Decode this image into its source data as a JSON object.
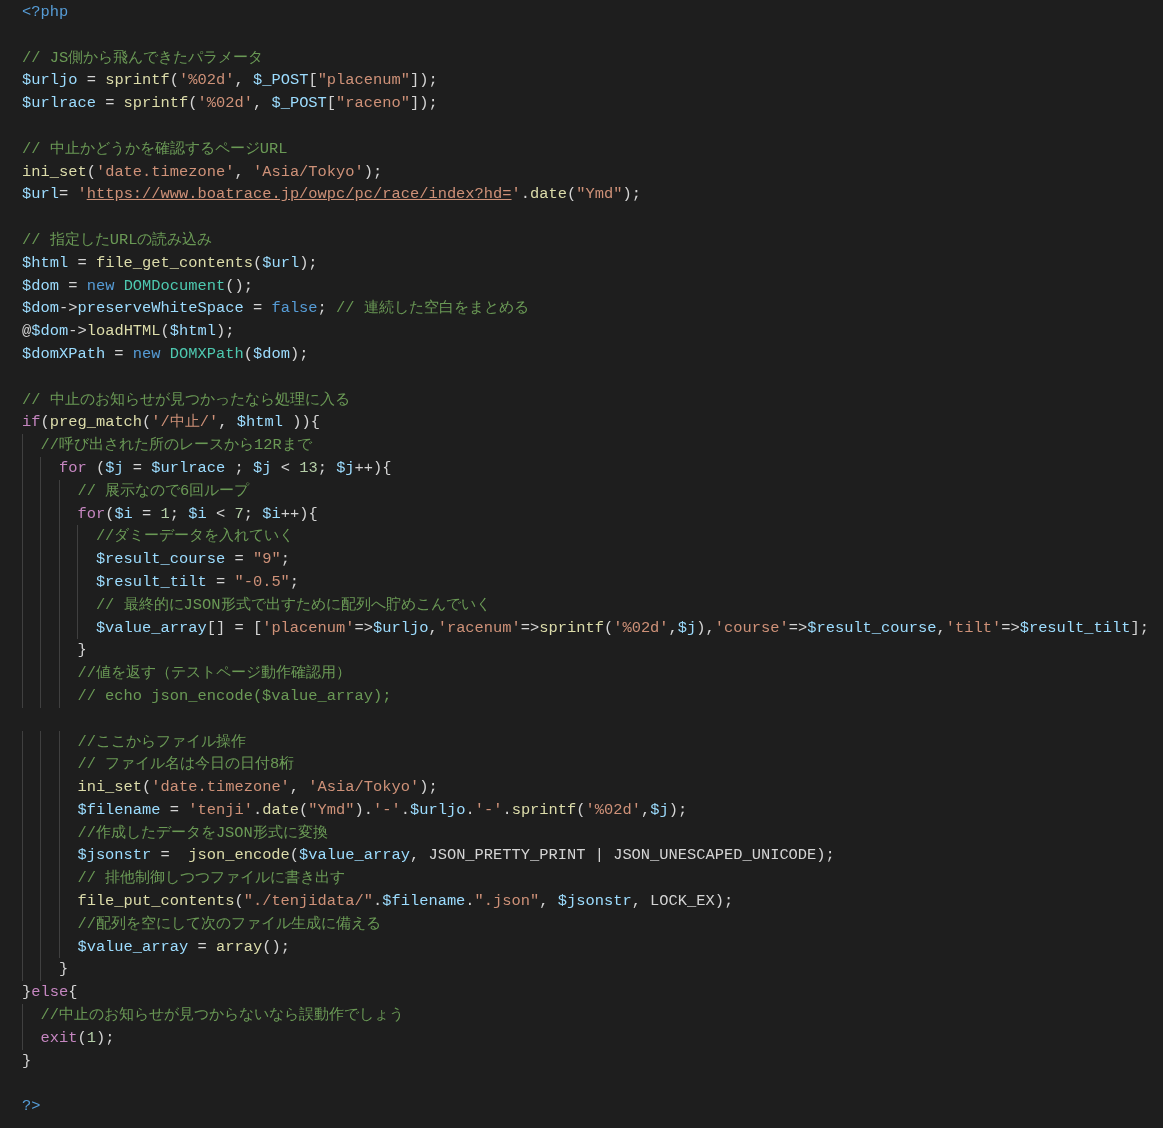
{
  "editor": {
    "lines": [
      {
        "kind": "code",
        "tokens": [
          {
            "kind": "kw",
            "text": "<?php"
          }
        ]
      },
      {
        "kind": "blank"
      },
      {
        "kind": "code",
        "tokens": [
          {
            "kind": "cmt",
            "text": "// JS側から飛んできたパラメータ"
          }
        ]
      },
      {
        "kind": "code",
        "tokens": [
          {
            "kind": "var",
            "text": "$urljo"
          },
          {
            "kind": "txt",
            "text": " = "
          },
          {
            "kind": "fn",
            "text": "sprintf"
          },
          {
            "kind": "txt",
            "text": "("
          },
          {
            "kind": "str",
            "text": "'%02d'"
          },
          {
            "kind": "txt",
            "text": ", "
          },
          {
            "kind": "var",
            "text": "$_POST"
          },
          {
            "kind": "txt",
            "text": "["
          },
          {
            "kind": "str",
            "text": "\"placenum\""
          },
          {
            "kind": "txt",
            "text": "]);"
          }
        ]
      },
      {
        "kind": "code",
        "tokens": [
          {
            "kind": "var",
            "text": "$urlrace"
          },
          {
            "kind": "txt",
            "text": " = "
          },
          {
            "kind": "fn",
            "text": "sprintf"
          },
          {
            "kind": "txt",
            "text": "("
          },
          {
            "kind": "str",
            "text": "'%02d'"
          },
          {
            "kind": "txt",
            "text": ", "
          },
          {
            "kind": "var",
            "text": "$_POST"
          },
          {
            "kind": "txt",
            "text": "["
          },
          {
            "kind": "str",
            "text": "\"raceno\""
          },
          {
            "kind": "txt",
            "text": "]);"
          }
        ]
      },
      {
        "kind": "blank"
      },
      {
        "kind": "code",
        "tokens": [
          {
            "kind": "cmt",
            "text": "// 中止かどうかを確認するページURL"
          }
        ]
      },
      {
        "kind": "code",
        "tokens": [
          {
            "kind": "fn",
            "text": "ini_set"
          },
          {
            "kind": "txt",
            "text": "("
          },
          {
            "kind": "str",
            "text": "'date.timezone'"
          },
          {
            "kind": "txt",
            "text": ", "
          },
          {
            "kind": "str",
            "text": "'Asia/Tokyo'"
          },
          {
            "kind": "txt",
            "text": ");"
          }
        ]
      },
      {
        "kind": "code",
        "tokens": [
          {
            "kind": "var",
            "text": "$url"
          },
          {
            "kind": "txt",
            "text": "= "
          },
          {
            "kind": "str",
            "text": "'"
          },
          {
            "kind": "link",
            "text": "https://www.boatrace.jp/owpc/pc/race/index?hd="
          },
          {
            "kind": "str",
            "text": "'"
          },
          {
            "kind": "txt",
            "text": "."
          },
          {
            "kind": "fn",
            "text": "date"
          },
          {
            "kind": "txt",
            "text": "("
          },
          {
            "kind": "str",
            "text": "\"Ymd\""
          },
          {
            "kind": "txt",
            "text": ");"
          }
        ]
      },
      {
        "kind": "blank"
      },
      {
        "kind": "code",
        "tokens": [
          {
            "kind": "cmt",
            "text": "// 指定したURLの読み込み"
          }
        ]
      },
      {
        "kind": "code",
        "tokens": [
          {
            "kind": "var",
            "text": "$html"
          },
          {
            "kind": "txt",
            "text": " = "
          },
          {
            "kind": "fn",
            "text": "file_get_contents"
          },
          {
            "kind": "txt",
            "text": "("
          },
          {
            "kind": "var",
            "text": "$url"
          },
          {
            "kind": "txt",
            "text": ");"
          }
        ]
      },
      {
        "kind": "code",
        "tokens": [
          {
            "kind": "var",
            "text": "$dom"
          },
          {
            "kind": "txt",
            "text": " = "
          },
          {
            "kind": "kw",
            "text": "new "
          },
          {
            "kind": "cls",
            "text": "DOMDocument"
          },
          {
            "kind": "txt",
            "text": "();"
          }
        ]
      },
      {
        "kind": "code",
        "tokens": [
          {
            "kind": "var",
            "text": "$dom"
          },
          {
            "kind": "txt",
            "text": "->"
          },
          {
            "kind": "var",
            "text": "preserveWhiteSpace"
          },
          {
            "kind": "txt",
            "text": " = "
          },
          {
            "kind": "kw",
            "text": "false"
          },
          {
            "kind": "txt",
            "text": "; "
          },
          {
            "kind": "cmt",
            "text": "// 連続した空白をまとめる"
          }
        ]
      },
      {
        "kind": "code",
        "tokens": [
          {
            "kind": "txt",
            "text": "@"
          },
          {
            "kind": "var",
            "text": "$dom"
          },
          {
            "kind": "txt",
            "text": "->"
          },
          {
            "kind": "fn",
            "text": "loadHTML"
          },
          {
            "kind": "txt",
            "text": "("
          },
          {
            "kind": "var",
            "text": "$html"
          },
          {
            "kind": "txt",
            "text": ");"
          }
        ]
      },
      {
        "kind": "code",
        "tokens": [
          {
            "kind": "var",
            "text": "$domXPath"
          },
          {
            "kind": "txt",
            "text": " = "
          },
          {
            "kind": "kw",
            "text": "new "
          },
          {
            "kind": "cls",
            "text": "DOMXPath"
          },
          {
            "kind": "txt",
            "text": "("
          },
          {
            "kind": "var",
            "text": "$dom"
          },
          {
            "kind": "txt",
            "text": ");"
          }
        ]
      },
      {
        "kind": "blank"
      },
      {
        "kind": "code",
        "tokens": [
          {
            "kind": "cmt",
            "text": "// 中止のお知らせが見つかったなら処理に入る"
          }
        ]
      },
      {
        "kind": "code",
        "tokens": [
          {
            "kind": "ctl",
            "text": "if"
          },
          {
            "kind": "txt",
            "text": "("
          },
          {
            "kind": "fn",
            "text": "preg_match"
          },
          {
            "kind": "txt",
            "text": "("
          },
          {
            "kind": "str",
            "text": "'/中止/'"
          },
          {
            "kind": "txt",
            "text": ", "
          },
          {
            "kind": "var",
            "text": "$html"
          },
          {
            "kind": "txt",
            "text": " )){"
          }
        ]
      },
      {
        "kind": "code",
        "tokens": [
          {
            "kind": "cmt",
            "text": "  //呼び出された所のレースから12Rまで"
          }
        ]
      },
      {
        "kind": "code",
        "tokens": [
          {
            "kind": "ctl",
            "text": "    for"
          },
          {
            "kind": "txt",
            "text": " ("
          },
          {
            "kind": "var",
            "text": "$j"
          },
          {
            "kind": "txt",
            "text": " = "
          },
          {
            "kind": "var",
            "text": "$urlrace"
          },
          {
            "kind": "txt",
            "text": " ; "
          },
          {
            "kind": "var",
            "text": "$j"
          },
          {
            "kind": "txt",
            "text": " < "
          },
          {
            "kind": "num",
            "text": "13"
          },
          {
            "kind": "txt",
            "text": "; "
          },
          {
            "kind": "var",
            "text": "$j"
          },
          {
            "kind": "txt",
            "text": "++){"
          }
        ]
      },
      {
        "kind": "code",
        "tokens": [
          {
            "kind": "cmt",
            "text": "      // 展示なので6回ループ"
          }
        ]
      },
      {
        "kind": "code",
        "tokens": [
          {
            "kind": "ctl",
            "text": "      for"
          },
          {
            "kind": "txt",
            "text": "("
          },
          {
            "kind": "var",
            "text": "$i"
          },
          {
            "kind": "txt",
            "text": " = "
          },
          {
            "kind": "num",
            "text": "1"
          },
          {
            "kind": "txt",
            "text": "; "
          },
          {
            "kind": "var",
            "text": "$i"
          },
          {
            "kind": "txt",
            "text": " < "
          },
          {
            "kind": "num",
            "text": "7"
          },
          {
            "kind": "txt",
            "text": "; "
          },
          {
            "kind": "var",
            "text": "$i"
          },
          {
            "kind": "txt",
            "text": "++){"
          }
        ]
      },
      {
        "kind": "code",
        "tokens": [
          {
            "kind": "cmt",
            "text": "        //ダミーデータを入れていく"
          }
        ]
      },
      {
        "kind": "code",
        "tokens": [
          {
            "kind": "var",
            "text": "        $result_course"
          },
          {
            "kind": "txt",
            "text": " = "
          },
          {
            "kind": "str",
            "text": "\"9\""
          },
          {
            "kind": "txt",
            "text": ";"
          }
        ]
      },
      {
        "kind": "code",
        "tokens": [
          {
            "kind": "var",
            "text": "        $result_tilt"
          },
          {
            "kind": "txt",
            "text": " = "
          },
          {
            "kind": "str",
            "text": "\"-0.5\""
          },
          {
            "kind": "txt",
            "text": ";"
          }
        ]
      },
      {
        "kind": "code",
        "tokens": [
          {
            "kind": "cmt",
            "text": "        // 最終的にJSON形式で出すために配列へ貯めこんでいく"
          }
        ]
      },
      {
        "kind": "code",
        "tokens": [
          {
            "kind": "var",
            "text": "        $value_array"
          },
          {
            "kind": "txt",
            "text": "[] = ["
          },
          {
            "kind": "str",
            "text": "'placenum'"
          },
          {
            "kind": "txt",
            "text": "=>"
          },
          {
            "kind": "var",
            "text": "$urljo"
          },
          {
            "kind": "txt",
            "text": ","
          },
          {
            "kind": "str",
            "text": "'racenum'"
          },
          {
            "kind": "txt",
            "text": "=>"
          },
          {
            "kind": "fn",
            "text": "sprintf"
          },
          {
            "kind": "txt",
            "text": "("
          },
          {
            "kind": "str",
            "text": "'%02d'"
          },
          {
            "kind": "txt",
            "text": ","
          },
          {
            "kind": "var",
            "text": "$j"
          },
          {
            "kind": "txt",
            "text": "),"
          },
          {
            "kind": "str",
            "text": "'course'"
          },
          {
            "kind": "txt",
            "text": "=>"
          },
          {
            "kind": "var",
            "text": "$result_course"
          },
          {
            "kind": "txt",
            "text": ","
          },
          {
            "kind": "str",
            "text": "'tilt'"
          },
          {
            "kind": "txt",
            "text": "=>"
          },
          {
            "kind": "var",
            "text": "$result_tilt"
          },
          {
            "kind": "txt",
            "text": "];"
          }
        ]
      },
      {
        "kind": "code",
        "tokens": [
          {
            "kind": "txt",
            "text": "      }"
          }
        ]
      },
      {
        "kind": "code",
        "tokens": [
          {
            "kind": "cmt",
            "text": "      //値を返す（テストページ動作確認用）"
          }
        ]
      },
      {
        "kind": "code",
        "tokens": [
          {
            "kind": "cmt",
            "text": "      // echo json_encode($value_array);"
          }
        ]
      },
      {
        "kind": "blank"
      },
      {
        "kind": "code",
        "tokens": [
          {
            "kind": "cmt",
            "text": "      //ここからファイル操作"
          }
        ]
      },
      {
        "kind": "code",
        "tokens": [
          {
            "kind": "cmt",
            "text": "      // ファイル名は今日の日付8桁"
          }
        ]
      },
      {
        "kind": "code",
        "tokens": [
          {
            "kind": "fn",
            "text": "      ini_set"
          },
          {
            "kind": "txt",
            "text": "("
          },
          {
            "kind": "str",
            "text": "'date.timezone'"
          },
          {
            "kind": "txt",
            "text": ", "
          },
          {
            "kind": "str",
            "text": "'Asia/Tokyo'"
          },
          {
            "kind": "txt",
            "text": ");"
          }
        ]
      },
      {
        "kind": "code",
        "tokens": [
          {
            "kind": "var",
            "text": "      $filename"
          },
          {
            "kind": "txt",
            "text": " = "
          },
          {
            "kind": "str",
            "text": "'tenji'"
          },
          {
            "kind": "txt",
            "text": "."
          },
          {
            "kind": "fn",
            "text": "date"
          },
          {
            "kind": "txt",
            "text": "("
          },
          {
            "kind": "str",
            "text": "\"Ymd\""
          },
          {
            "kind": "txt",
            "text": ")."
          },
          {
            "kind": "str",
            "text": "'-'"
          },
          {
            "kind": "txt",
            "text": "."
          },
          {
            "kind": "var",
            "text": "$urljo"
          },
          {
            "kind": "txt",
            "text": "."
          },
          {
            "kind": "str",
            "text": "'-'"
          },
          {
            "kind": "txt",
            "text": "."
          },
          {
            "kind": "fn",
            "text": "sprintf"
          },
          {
            "kind": "txt",
            "text": "("
          },
          {
            "kind": "str",
            "text": "'%02d'"
          },
          {
            "kind": "txt",
            "text": ","
          },
          {
            "kind": "var",
            "text": "$j"
          },
          {
            "kind": "txt",
            "text": ");"
          }
        ]
      },
      {
        "kind": "code",
        "tokens": [
          {
            "kind": "cmt",
            "text": "      //作成したデータをJSON形式に変換"
          }
        ]
      },
      {
        "kind": "code",
        "tokens": [
          {
            "kind": "var",
            "text": "      $jsonstr"
          },
          {
            "kind": "txt",
            "text": " =  "
          },
          {
            "kind": "fn",
            "text": "json_encode"
          },
          {
            "kind": "txt",
            "text": "("
          },
          {
            "kind": "var",
            "text": "$value_array"
          },
          {
            "kind": "txt",
            "text": ", JSON_PRETTY_PRINT | JSON_UNESCAPED_UNICODE);"
          }
        ]
      },
      {
        "kind": "code",
        "tokens": [
          {
            "kind": "cmt",
            "text": "      // 排他制御しつつファイルに書き出す"
          }
        ]
      },
      {
        "kind": "code",
        "tokens": [
          {
            "kind": "fn",
            "text": "      file_put_contents"
          },
          {
            "kind": "txt",
            "text": "("
          },
          {
            "kind": "str",
            "text": "\"./tenjidata/\""
          },
          {
            "kind": "txt",
            "text": "."
          },
          {
            "kind": "var",
            "text": "$filename"
          },
          {
            "kind": "txt",
            "text": "."
          },
          {
            "kind": "str",
            "text": "\".json\""
          },
          {
            "kind": "txt",
            "text": ", "
          },
          {
            "kind": "var",
            "text": "$jsonstr"
          },
          {
            "kind": "txt",
            "text": ", LOCK_EX);"
          }
        ]
      },
      {
        "kind": "code",
        "tokens": [
          {
            "kind": "cmt",
            "text": "      //配列を空にして次のファイル生成に備える"
          }
        ]
      },
      {
        "kind": "code",
        "tokens": [
          {
            "kind": "var",
            "text": "      $value_array"
          },
          {
            "kind": "txt",
            "text": " = "
          },
          {
            "kind": "fn",
            "text": "array"
          },
          {
            "kind": "txt",
            "text": "();"
          }
        ]
      },
      {
        "kind": "code",
        "tokens": [
          {
            "kind": "txt",
            "text": "    }"
          }
        ]
      },
      {
        "kind": "code",
        "tokens": [
          {
            "kind": "txt",
            "text": "}"
          },
          {
            "kind": "ctl",
            "text": "else"
          },
          {
            "kind": "txt",
            "text": "{"
          }
        ]
      },
      {
        "kind": "code",
        "tokens": [
          {
            "kind": "cmt",
            "text": "  //中止のお知らせが見つからないなら誤動作でしょう"
          }
        ]
      },
      {
        "kind": "code",
        "tokens": [
          {
            "kind": "ctl",
            "text": "  exit"
          },
          {
            "kind": "txt",
            "text": "("
          },
          {
            "kind": "num",
            "text": "1"
          },
          {
            "kind": "txt",
            "text": ");"
          }
        ]
      },
      {
        "kind": "code",
        "tokens": [
          {
            "kind": "txt",
            "text": "}"
          }
        ]
      },
      {
        "kind": "blank"
      },
      {
        "kind": "code",
        "tokens": [
          {
            "kind": "kw",
            "text": "?>"
          }
        ]
      }
    ]
  }
}
